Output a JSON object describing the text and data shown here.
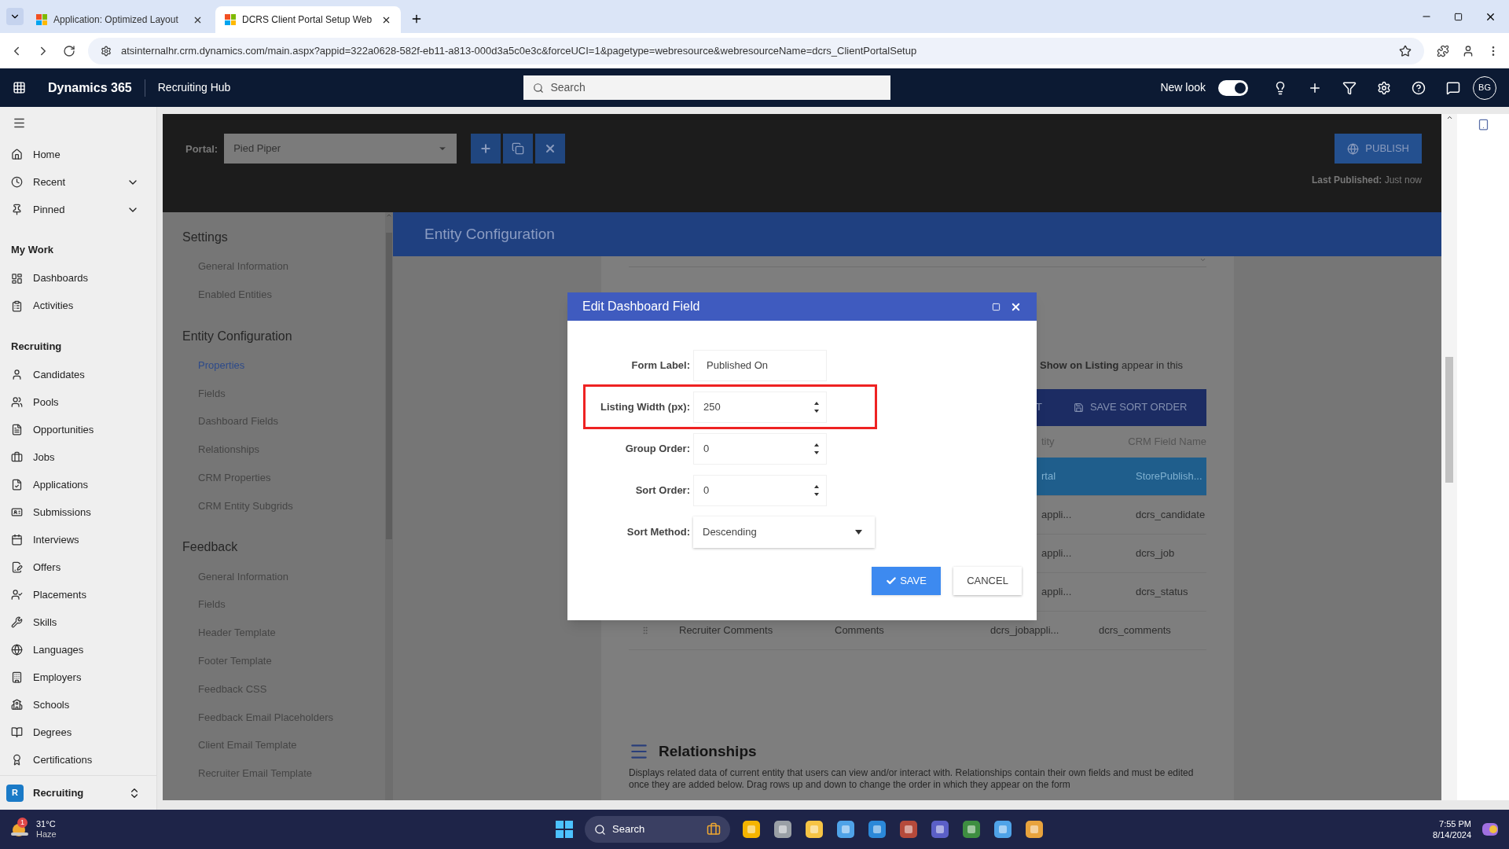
{
  "browser": {
    "tabs": [
      {
        "title": "Application: Optimized Layout",
        "selected": false
      },
      {
        "title": "DCRS Client Portal Setup Web",
        "selected": true
      }
    ],
    "url": "atsinternalhr.crm.dynamics.com/main.aspx?appid=322a0628-582f-eb11-a813-000d3a5c0e3c&forceUCI=1&pagetype=webresource&webresourceName=dcrs_ClientPortalSetup"
  },
  "app_header": {
    "brand": "Dynamics 365",
    "app_name": "Recruiting Hub",
    "search_placeholder": "Search",
    "new_look_label": "New look",
    "new_look_on": true,
    "avatar": "BG"
  },
  "sidebar": {
    "items": [
      {
        "kind": "item",
        "label": "Home",
        "expandable": false
      },
      {
        "kind": "item",
        "label": "Recent",
        "expandable": true
      },
      {
        "kind": "item",
        "label": "Pinned",
        "expandable": true
      },
      {
        "kind": "header",
        "label": "My Work"
      },
      {
        "kind": "item",
        "label": "Dashboards",
        "expandable": false
      },
      {
        "kind": "item",
        "label": "Activities",
        "expandable": false
      },
      {
        "kind": "header",
        "label": "Recruiting"
      },
      {
        "kind": "item",
        "label": "Candidates",
        "expandable": false
      },
      {
        "kind": "item",
        "label": "Pools",
        "expandable": false
      },
      {
        "kind": "item",
        "label": "Opportunities",
        "expandable": false
      },
      {
        "kind": "item",
        "label": "Jobs",
        "expandable": false
      },
      {
        "kind": "item",
        "label": "Applications",
        "expandable": false
      },
      {
        "kind": "item",
        "label": "Submissions",
        "expandable": false
      },
      {
        "kind": "item",
        "label": "Interviews",
        "expandable": false
      },
      {
        "kind": "item",
        "label": "Offers",
        "expandable": false
      },
      {
        "kind": "item",
        "label": "Placements",
        "expandable": false
      },
      {
        "kind": "item",
        "label": "Skills",
        "expandable": false
      },
      {
        "kind": "item",
        "label": "Languages",
        "expandable": false
      },
      {
        "kind": "item",
        "label": "Employers",
        "expandable": false
      },
      {
        "kind": "item",
        "label": "Schools",
        "expandable": false
      },
      {
        "kind": "item",
        "label": "Degrees",
        "expandable": false
      },
      {
        "kind": "item",
        "label": "Certifications",
        "expandable": false
      }
    ],
    "area": {
      "badge": "R",
      "label": "Recruiting"
    }
  },
  "portal_bar": {
    "label": "Portal:",
    "value": "Pied Piper",
    "publish": "PUBLISH",
    "last_published_label": "Last Published:",
    "last_published_value": "Just now"
  },
  "nav": [
    {
      "title": "Settings",
      "items": [
        {
          "label": "General Information",
          "selected": false
        },
        {
          "label": "Enabled Entities",
          "selected": false
        }
      ]
    },
    {
      "title": "Entity Configuration",
      "items": [
        {
          "label": "Properties",
          "selected": true
        },
        {
          "label": "Fields",
          "selected": false
        },
        {
          "label": "Dashboard Fields",
          "selected": false
        },
        {
          "label": "Relationships",
          "selected": false
        },
        {
          "label": "CRM Properties",
          "selected": false
        },
        {
          "label": "CRM Entity Subgrids",
          "selected": false
        }
      ]
    },
    {
      "title": "Feedback",
      "items": [
        {
          "label": "General Information",
          "selected": false
        },
        {
          "label": "Fields",
          "selected": false
        },
        {
          "label": "Header Template",
          "selected": false
        },
        {
          "label": "Footer Template",
          "selected": false
        },
        {
          "label": "Feedback CSS",
          "selected": false
        },
        {
          "label": "Feedback Email Placeholders",
          "selected": false
        },
        {
          "label": "Client Email Template",
          "selected": false
        },
        {
          "label": "Recruiter Email Template",
          "selected": false
        }
      ]
    }
  ],
  "page_title": "Entity Configuration",
  "background": {
    "listing_note": "**Show on Listing** appear in this",
    "toolbar_partial": "T",
    "save_sort": "SAVE SORT ORDER",
    "columns": [
      "tity",
      "CRM Field Name"
    ],
    "rows": [
      {
        "selected": true,
        "cells": [
          "rtal",
          "StorePublish..."
        ]
      },
      {
        "selected": false,
        "cells": [
          "appli...",
          "dcrs_candidate"
        ]
      },
      {
        "selected": false,
        "cells": [
          "appli...",
          "dcrs_job"
        ]
      },
      {
        "selected": false,
        "cells": [
          "appli...",
          "dcrs_status"
        ]
      },
      {
        "selected": false,
        "cells": [
          "Recruiter Comments",
          "Comments",
          "dcrs_jobappli...",
          "dcrs_comments"
        ]
      }
    ],
    "relationships_title": "Relationships",
    "relationships_text": "Displays related data of current entity that users can view and/or interact with. Relationships contain their own fields and must be edited once they are added below. Drag rows up and down to change the order in which they appear on the form"
  },
  "dialog": {
    "title": "Edit Dashboard Field",
    "fields": [
      {
        "kind": "text",
        "label": "Form Label:",
        "value": "Published On",
        "highlighted": false
      },
      {
        "kind": "number",
        "label": "Listing Width (px):",
        "value": "250",
        "highlighted": true
      },
      {
        "kind": "number",
        "label": "Group Order:",
        "value": "0",
        "highlighted": false
      },
      {
        "kind": "number",
        "label": "Sort Order:",
        "value": "0",
        "highlighted": false
      },
      {
        "kind": "select",
        "label": "Sort Method:",
        "value": "Descending",
        "highlighted": false
      }
    ],
    "save": "SAVE",
    "cancel": "CANCEL"
  },
  "taskbar": {
    "temperature": "31°C",
    "weather": "Haze",
    "weather_badge": "1",
    "search": "Search",
    "time": "7:55 PM",
    "date": "8/14/2024"
  }
}
